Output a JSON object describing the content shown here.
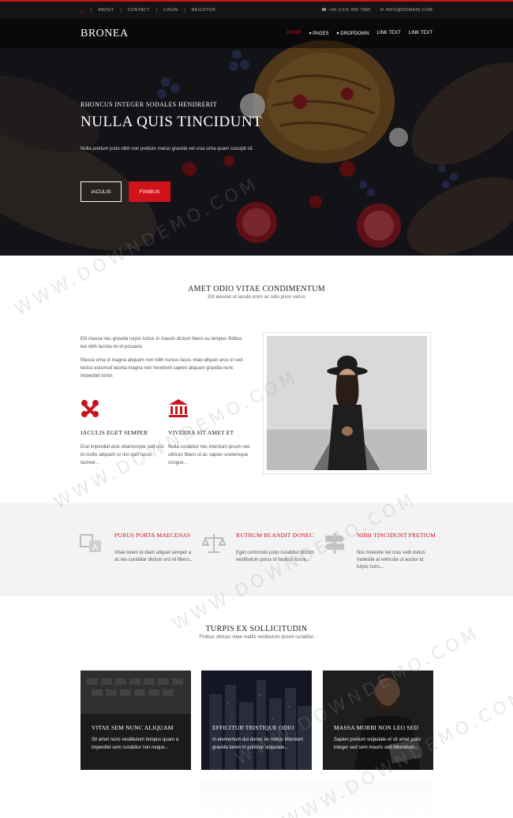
{
  "topbar": {
    "links": [
      "ABOUT",
      "CONTACT",
      "LOGIN",
      "REGISTER"
    ],
    "phone": "+00 (123) 456 7890",
    "email": "INFO@DOMAIN.COM"
  },
  "header": {
    "brand": "BRONEA",
    "nav": [
      {
        "label": "HOME",
        "active": true
      },
      {
        "label": "▾ PAGES",
        "active": false
      },
      {
        "label": "▾ DROPDOWN",
        "active": false
      },
      {
        "label": "LINK TEXT",
        "active": false
      },
      {
        "label": "LINK TEXT",
        "active": false
      }
    ]
  },
  "hero": {
    "subtitle": "RHONCUS INTEGER SODALES HENDRERIT",
    "title": "NULLA QUIS TINCIDUNT",
    "text": "Nulla pretium justo nibh non pretium metus gravida vel cras urna quam suscipit sit.",
    "button1": "IACULIS",
    "button2": "FINIBUS"
  },
  "about": {
    "title": "AMET ODIO VITAE CONDIMENTUM",
    "subtitle": "Elit aenean at iaculis enim ac odio proin varius",
    "para1": "Elit massa nec gravida turpis luctus in mauris dictum libero eu tempus finibus leo nibh lacinia mi et posuere.",
    "para2": "Massa urna ut magna aliquam non nibh cursus lacus vitae aliquet arcu ut sed lectus euismod lacinia magna non hendrerit sapien aliquam gravida nunc imperdiet tortor.",
    "features": [
      {
        "icon": "joomla-icon",
        "title": "IACULIS EGET SEMPER",
        "text": "Erat imperdiet duis ullamcorper sed orci id mollis aliquam ut nisl quis lacus laoreet..."
      },
      {
        "icon": "bank-icon",
        "title": "VIVERRA SIT AMET ET",
        "text": "Nulla curabitur nec interdum ipsum nec ultrices libero ut ac sapien scelerisque congue..."
      }
    ]
  },
  "services": [
    {
      "icon": "translate-icon",
      "title": "PURUS PORTA MAECENAS",
      "text": "Vitae lorem id diam aliquet semper a ac leo curabitur dictum orci et libero..."
    },
    {
      "icon": "balance-scale-icon",
      "title": "RUTRUM BLANDIT DONEC",
      "text": "Eget commodo justo curabitur dictum vestibulum purus id facilisis fusce..."
    },
    {
      "icon": "signpost-icon",
      "title": "NIBH TINCIDUNT PRETIUM",
      "text": "Nisi molestie vel cras velit metus molestie at vehicula ut auctor at turpis nunc..."
    }
  ],
  "blog": {
    "title": "TURPIS EX SOLLICITUDIN",
    "subtitle": "Finibus ultrices vitae mattis vestibulum ipsum curabitur",
    "cards": [
      {
        "title": "VITAE SEM NUNC ALIQUAM",
        "text": "Sit amet nunc vestibulum tempus quam a imperdiet sem curabitur non neque..."
      },
      {
        "title": "EFFICITUR TRISTIQUE ODIO",
        "text": "In elementum dui donec ex metus interdum gravida lorem in pulvinar vulputate..."
      },
      {
        "title": "MASSA MORBI NON LEO SED",
        "text": "Sapien pretium vulputate et sit amet justo integer sed sem mauris sed bibendum..."
      }
    ]
  },
  "watermark": "WWW.DOWNDEMO.COM",
  "colors": {
    "accent": "#d0121b",
    "topbar": "#141414",
    "band": "#f3f3f3"
  }
}
